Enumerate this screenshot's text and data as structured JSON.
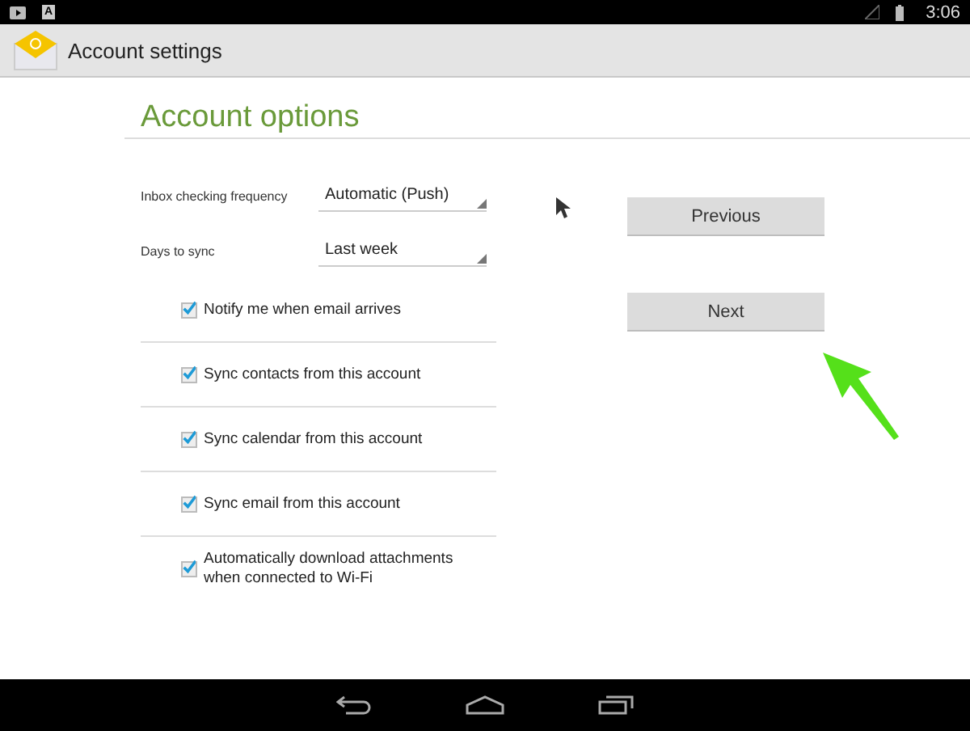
{
  "status_bar": {
    "badge": "A",
    "time": "3:06"
  },
  "action_bar": {
    "title": "Account settings"
  },
  "heading": "Account options",
  "settings": [
    {
      "label": "Inbox checking frequency",
      "value": "Automatic (Push)"
    },
    {
      "label": "Days to sync",
      "value": "Last week"
    }
  ],
  "options": [
    {
      "label": "Notify me when email arrives",
      "checked": true
    },
    {
      "label": "Sync contacts from this account",
      "checked": true
    },
    {
      "label": "Sync calendar from this account",
      "checked": true
    },
    {
      "label": "Sync email from this account",
      "checked": true
    },
    {
      "label": "Automatically download attachments when connected to Wi-Fi",
      "checked": true
    }
  ],
  "buttons": [
    "Previous",
    "Next"
  ]
}
